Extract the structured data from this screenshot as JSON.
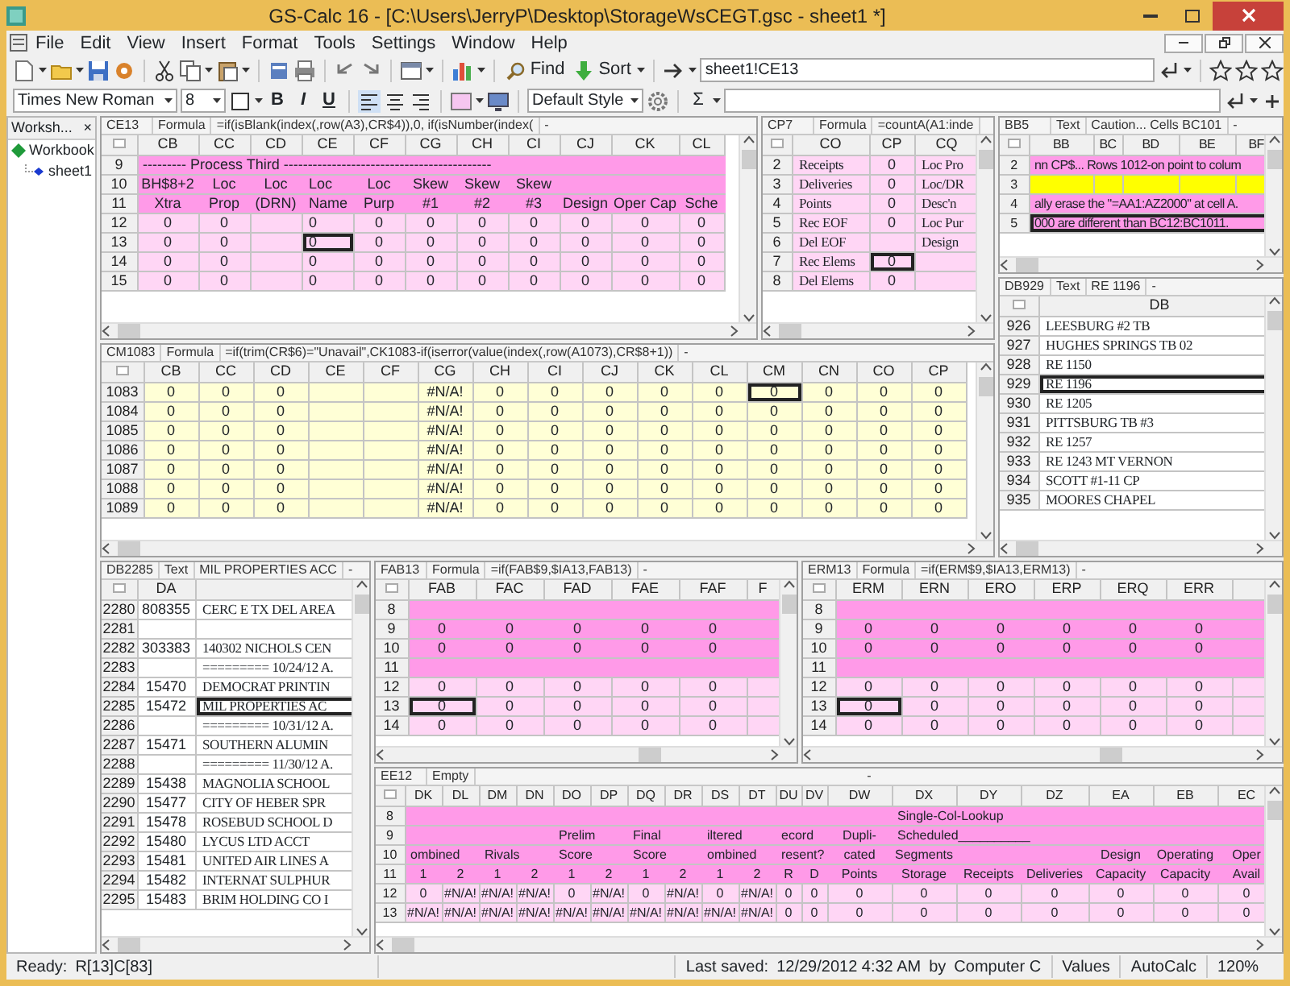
{
  "window": {
    "title": "GS-Calc 16 - [C:\\Users\\JerryP\\Desktop\\StorageWsCEGT.gsc - sheet1 *]"
  },
  "menu": [
    "File",
    "Edit",
    "View",
    "Insert",
    "Format",
    "Tools",
    "Settings",
    "Window",
    "Help"
  ],
  "toolbar": {
    "find": "Find",
    "sort": "Sort",
    "cell_reference": "sheet1!CE13"
  },
  "format_bar": {
    "font": "Times New Roman",
    "size": "8",
    "bold": "B",
    "italic": "I",
    "underline": "U",
    "style": "Default Style",
    "sum": "Σ"
  },
  "sidebar": {
    "title": "Worksh...",
    "close": "×",
    "tree": [
      {
        "label": "Workbook",
        "children": [
          {
            "label": "sheet1"
          }
        ]
      }
    ]
  },
  "panes": [
    {
      "ref": "CE13",
      "type": "Formula",
      "content": "=if(isBlank(index(,row(A3),CR$4)),0,   if(isNumber(index(",
      "suffix": "-",
      "columns": [
        {
          "label": "CB",
          "kind": "number"
        },
        {
          "label": "CC",
          "kind": "number"
        },
        {
          "label": "CD",
          "kind": "number"
        },
        {
          "label": "CE",
          "kind": "left"
        },
        {
          "label": "CF",
          "kind": "number"
        },
        {
          "label": "CG",
          "kind": "number"
        },
        {
          "label": "CH",
          "kind": "number"
        },
        {
          "label": "CI",
          "kind": "number"
        },
        {
          "label": "CJ",
          "kind": "number"
        },
        {
          "label": "CK",
          "kind": "number"
        },
        {
          "label": "CL",
          "kind": "number"
        }
      ],
      "rows": [
        {
          "header": "9",
          "kind": "heading",
          "cells": [
            {
              "text": "--------- Process Third -------------------------------------------",
              "colspan": 11
            }
          ]
        },
        {
          "header": "10",
          "kind": "heading",
          "cells": [
            "BH$8+2",
            "Loc",
            "Loc",
            "Loc",
            "Loc",
            "Skew",
            "Skew",
            "Skew",
            "",
            "",
            ""
          ]
        },
        {
          "header": "11",
          "kind": "heading",
          "cells": [
            "Xtra",
            "Prop",
            "(DRN)",
            "Name",
            "Purp",
            "#1",
            "#2",
            "#3",
            "Design",
            "Oper Cap",
            "Sche"
          ]
        },
        {
          "header": "12",
          "kind": "data",
          "cells": [
            "0",
            "0",
            "",
            "0",
            "0",
            "0",
            "0",
            "0",
            "0",
            "0",
            "0"
          ]
        },
        {
          "header": "13",
          "kind": "data",
          "cells": [
            "0",
            "0",
            "",
            {
              "text": "0",
              "selected": true
            },
            "0",
            "0",
            "0",
            "0",
            "0",
            "0",
            "0"
          ]
        },
        {
          "header": "14",
          "kind": "data",
          "cells": [
            "0",
            "0",
            "",
            "0",
            "0",
            "0",
            "0",
            "0",
            "0",
            "0",
            "0"
          ]
        },
        {
          "header": "15",
          "kind": "data",
          "cells": [
            "0",
            "0",
            "",
            "0",
            "0",
            "0",
            "0",
            "0",
            "0",
            "0",
            "0"
          ]
        }
      ]
    },
    {
      "ref": "CP7",
      "type": "Formula",
      "content": "=countA(A1:inde",
      "columns": [
        {
          "label": "CO",
          "kind": "text"
        },
        {
          "label": "CP",
          "kind": "number"
        },
        {
          "label": "CQ",
          "kind": "text"
        }
      ],
      "rows": [
        {
          "header": "2",
          "kind": "data",
          "cells": [
            "Receipts",
            "0",
            "Loc Pro"
          ]
        },
        {
          "header": "3",
          "kind": "data",
          "cells": [
            "Deliveries",
            "0",
            "Loc/DR"
          ]
        },
        {
          "header": "4",
          "kind": "data",
          "cells": [
            "Points",
            "0",
            "Desc'n"
          ]
        },
        {
          "header": "5",
          "kind": "data",
          "cells": [
            "Rec EOF",
            "0",
            "Loc Pur"
          ]
        },
        {
          "header": "6",
          "kind": "data",
          "cells": [
            "Del EOF",
            "",
            "Design"
          ]
        },
        {
          "header": "7",
          "kind": "data",
          "cells": [
            "Rec Elems",
            {
              "text": "0",
              "selected": true
            },
            ""
          ]
        },
        {
          "header": "8",
          "kind": "data",
          "cells": [
            "Del Elems",
            "0",
            ""
          ]
        }
      ]
    },
    {
      "ref": "CM1083",
      "type": "Formula",
      "content": "=if(trim(CR$6)=\"Unavail\",CK1083-if(iserror(value(index(,row(A1073),CR$8+1))",
      "suffix": "-",
      "columns": [
        {
          "label": "CB",
          "kind": "number"
        },
        {
          "label": "CC",
          "kind": "number"
        },
        {
          "label": "CD",
          "kind": "number"
        },
        {
          "label": "CE",
          "kind": "number"
        },
        {
          "label": "CF",
          "kind": "number"
        },
        {
          "label": "CG",
          "kind": "number"
        },
        {
          "label": "CH",
          "kind": "number"
        },
        {
          "label": "CI",
          "kind": "number"
        },
        {
          "label": "CJ",
          "kind": "number"
        },
        {
          "label": "CK",
          "kind": "number"
        },
        {
          "label": "CL",
          "kind": "number"
        },
        {
          "label": "CM",
          "kind": "number"
        },
        {
          "label": "CN",
          "kind": "number"
        },
        {
          "label": "CO",
          "kind": "number"
        },
        {
          "label": "CP",
          "kind": "number"
        }
      ],
      "rows": [
        {
          "header": "1083",
          "kind": "input",
          "cells": [
            "0",
            "0",
            "0",
            "",
            "",
            "#N/A!",
            "0",
            "0",
            "0",
            "0",
            "0",
            {
              "text": "0",
              "selected": true
            },
            "0",
            "0",
            "0"
          ]
        },
        {
          "header": "1084",
          "kind": "input",
          "cells": [
            "0",
            "0",
            "0",
            "",
            "",
            "#N/A!",
            "0",
            "0",
            "0",
            "0",
            "0",
            "0",
            "0",
            "0",
            "0"
          ]
        },
        {
          "header": "1085",
          "kind": "input",
          "cells": [
            "0",
            "0",
            "0",
            "",
            "",
            "#N/A!",
            "0",
            "0",
            "0",
            "0",
            "0",
            "0",
            "0",
            "0",
            "0"
          ]
        },
        {
          "header": "1086",
          "kind": "input",
          "cells": [
            "0",
            "0",
            "0",
            "",
            "",
            "#N/A!",
            "0",
            "0",
            "0",
            "0",
            "0",
            "0",
            "0",
            "0",
            "0"
          ]
        },
        {
          "header": "1087",
          "kind": "input",
          "cells": [
            "0",
            "0",
            "0",
            "",
            "",
            "#N/A!",
            "0",
            "0",
            "0",
            "0",
            "0",
            "0",
            "0",
            "0",
            "0"
          ]
        },
        {
          "header": "1088",
          "kind": "input",
          "cells": [
            "0",
            "0",
            "0",
            "",
            "",
            "#N/A!",
            "0",
            "0",
            "0",
            "0",
            "0",
            "0",
            "0",
            "0",
            "0"
          ]
        },
        {
          "header": "1089",
          "kind": "input",
          "cells": [
            "0",
            "0",
            "0",
            "",
            "",
            "#N/A!",
            "0",
            "0",
            "0",
            "0",
            "0",
            "0",
            "0",
            "0",
            "0"
          ]
        }
      ]
    },
    {
      "ref": "BB5",
      "type": "Text",
      "content": "Caution... Cells BC101",
      "suffix": "-",
      "columns": [
        {
          "label": "BB",
          "kind": "left"
        },
        {
          "label": "BC",
          "kind": "left"
        },
        {
          "label": "BD",
          "kind": "left"
        },
        {
          "label": "BE",
          "kind": "left"
        },
        {
          "label": "BF",
          "kind": "left"
        }
      ],
      "rows": [
        {
          "header": "2",
          "kind": "heading",
          "cells": [
            {
              "text": "nn CP$... Rows 1012-on point to colum",
              "colspan": 5
            }
          ]
        },
        {
          "header": "3",
          "kind": "highlight",
          "cells": [
            "",
            "",
            "",
            "",
            ""
          ]
        },
        {
          "header": "4",
          "kind": "heading",
          "cells": [
            {
              "text": "ally erase the \"=AA1:AZ2000\" at cell A.",
              "colspan": 5
            }
          ]
        },
        {
          "header": "5",
          "kind": "heading",
          "cells": [
            {
              "text": "000 are different than BC12:BC1011.",
              "selected": true,
              "colspan": 5
            }
          ]
        }
      ]
    },
    {
      "ref": "DB929",
      "type": "Text",
      "content": "RE 1196",
      "suffix": "-",
      "columns": [
        {
          "label": "DB",
          "kind": "text"
        }
      ],
      "rows": [
        {
          "header": "926",
          "kind": "plain",
          "cells": [
            "LEESBURG #2 TB"
          ]
        },
        {
          "header": "927",
          "kind": "plain",
          "cells": [
            "HUGHES SPRINGS TB 02"
          ]
        },
        {
          "header": "928",
          "kind": "plain",
          "cells": [
            "RE 1150"
          ]
        },
        {
          "header": "929",
          "kind": "plain",
          "cells": [
            {
              "text": "RE 1196",
              "selected": true
            }
          ]
        },
        {
          "header": "930",
          "kind": "plain",
          "cells": [
            "RE 1205"
          ]
        },
        {
          "header": "931",
          "kind": "plain",
          "cells": [
            "PITTSBURG TB #3"
          ]
        },
        {
          "header": "932",
          "kind": "plain",
          "cells": [
            "RE 1257"
          ]
        },
        {
          "header": "933",
          "kind": "plain",
          "cells": [
            "RE 1243 MT VERNON"
          ]
        },
        {
          "header": "934",
          "kind": "plain",
          "cells": [
            "SCOTT #1-11 CP"
          ]
        },
        {
          "header": "935",
          "kind": "plain",
          "cells": [
            "MOORES CHAPEL"
          ]
        }
      ]
    },
    {
      "ref": "DB2285",
      "type": "Text",
      "content": "MIL PROPERTIES ACC",
      "suffix": "-",
      "columns": [
        {
          "label": "DA",
          "kind": "number"
        },
        {
          "kind": "text"
        }
      ],
      "rows": [
        {
          "header": "2280",
          "kind": "plain",
          "cells": [
            "808355",
            "CERC E TX DEL AREA"
          ]
        },
        {
          "header": "2281",
          "kind": "plain",
          "cells": [
            "",
            ""
          ]
        },
        {
          "header": "2282",
          "kind": "plain",
          "cells": [
            "303383",
            "140302 NICHOLS CEN"
          ]
        },
        {
          "header": "2283",
          "kind": "plain",
          "cells": [
            "",
            "========= 10/24/12 A."
          ]
        },
        {
          "header": "2284",
          "kind": "plain",
          "cells": [
            "15470",
            "DEMOCRAT PRINTIN"
          ]
        },
        {
          "header": "2285",
          "kind": "plain",
          "cells": [
            "15472",
            {
              "text": "MIL PROPERTIES AC",
              "selected": true
            }
          ]
        },
        {
          "header": "2286",
          "kind": "plain",
          "cells": [
            "",
            "========= 10/31/12 A."
          ]
        },
        {
          "header": "2287",
          "kind": "plain",
          "cells": [
            "15471",
            "SOUTHERN ALUMIN"
          ]
        },
        {
          "header": "2288",
          "kind": "plain",
          "cells": [
            "",
            "========= 11/30/12 A."
          ]
        },
        {
          "header": "2289",
          "kind": "plain",
          "cells": [
            "15438",
            "MAGNOLIA SCHOOL"
          ]
        },
        {
          "header": "2290",
          "kind": "plain",
          "cells": [
            "15477",
            "CITY OF HEBER SPR"
          ]
        },
        {
          "header": "2291",
          "kind": "plain",
          "cells": [
            "15478",
            "ROSEBUD SCHOOL D"
          ]
        },
        {
          "header": "2292",
          "kind": "plain",
          "cells": [
            "15480",
            "LYCUS LTD ACCT"
          ]
        },
        {
          "header": "2293",
          "kind": "plain",
          "cells": [
            "15481",
            "UNITED AIR LINES A"
          ]
        },
        {
          "header": "2294",
          "kind": "plain",
          "cells": [
            "15482",
            "INTERNAT SULPHUR"
          ]
        },
        {
          "header": "2295",
          "kind": "plain",
          "cells": [
            "15483",
            "BRIM HOLDING CO I"
          ]
        }
      ]
    },
    {
      "ref": "FAB13",
      "type": "Formula",
      "content": "=if(FAB$9,$IA13,FAB13)",
      "suffix": "-",
      "columns": [
        {
          "label": "FAB",
          "kind": "number"
        },
        {
          "label": "FAC",
          "kind": "number"
        },
        {
          "label": "FAD",
          "kind": "number"
        },
        {
          "label": "FAE",
          "kind": "number"
        },
        {
          "label": "FAF",
          "kind": "number"
        },
        {
          "label": "F",
          "kind": "number"
        }
      ],
      "rows": [
        {
          "header": "8",
          "kind": "heading",
          "cells": [
            "",
            "",
            "",
            "",
            "",
            ""
          ]
        },
        {
          "header": "9",
          "kind": "heading",
          "cells": [
            "0",
            "0",
            "0",
            "0",
            "0",
            ""
          ]
        },
        {
          "header": "10",
          "kind": "heading",
          "cells": [
            "0",
            "0",
            "0",
            "0",
            "0",
            ""
          ]
        },
        {
          "header": "11",
          "kind": "heading",
          "cells": [
            "",
            "",
            "",
            "",
            "",
            ""
          ]
        },
        {
          "header": "12",
          "kind": "data",
          "cells": [
            "0",
            "0",
            "0",
            "0",
            "0",
            ""
          ]
        },
        {
          "header": "13",
          "kind": "data",
          "cells": [
            {
              "text": "0",
              "selected": true
            },
            "0",
            "0",
            "0",
            "0",
            ""
          ]
        },
        {
          "header": "14",
          "kind": "data",
          "cells": [
            "0",
            "0",
            "0",
            "0",
            "0",
            ""
          ]
        }
      ]
    },
    {
      "ref": "ERM13",
      "type": "Formula",
      "content": "=if(ERM$9,$IA13,ERM13)",
      "suffix": "-",
      "columns": [
        {
          "label": "ERM",
          "kind": "number"
        },
        {
          "label": "ERN",
          "kind": "number"
        },
        {
          "label": "ERO",
          "kind": "number"
        },
        {
          "label": "ERP",
          "kind": "number"
        },
        {
          "label": "ERQ",
          "kind": "number"
        },
        {
          "label": "ERR",
          "kind": "number"
        },
        {
          "kind": "number"
        }
      ],
      "rows": [
        {
          "header": "8",
          "kind": "heading",
          "cells": [
            "",
            "",
            "",
            "",
            "",
            "",
            ""
          ]
        },
        {
          "header": "9",
          "kind": "heading",
          "cells": [
            "0",
            "0",
            "0",
            "0",
            "0",
            "0",
            ""
          ]
        },
        {
          "header": "10",
          "kind": "heading",
          "cells": [
            "0",
            "0",
            "0",
            "0",
            "0",
            "0",
            ""
          ]
        },
        {
          "header": "11",
          "kind": "heading",
          "cells": [
            "",
            "",
            "",
            "",
            "",
            "",
            ""
          ]
        },
        {
          "header": "12",
          "kind": "data",
          "cells": [
            "0",
            "0",
            "0",
            "0",
            "0",
            "0",
            ""
          ]
        },
        {
          "header": "13",
          "kind": "data",
          "cells": [
            {
              "text": "0",
              "selected": true
            },
            "0",
            "0",
            "0",
            "0",
            "0",
            ""
          ]
        },
        {
          "header": "14",
          "kind": "data",
          "cells": [
            "0",
            "0",
            "0",
            "0",
            "0",
            "0",
            ""
          ]
        }
      ]
    },
    {
      "ref": "EE12",
      "type": "Empty",
      "suffix": "-",
      "columns": [
        {
          "label": "DK",
          "kind": "number"
        },
        {
          "label": "DL",
          "kind": "number"
        },
        {
          "label": "DM",
          "kind": "number"
        },
        {
          "label": "DN",
          "kind": "number"
        },
        {
          "label": "DO",
          "kind": "number"
        },
        {
          "label": "DP",
          "kind": "number"
        },
        {
          "label": "DQ",
          "kind": "number"
        },
        {
          "label": "DR",
          "kind": "number"
        },
        {
          "label": "DS",
          "kind": "number"
        },
        {
          "label": "DT",
          "kind": "number"
        },
        {
          "label": "DU",
          "kind": "number"
        },
        {
          "label": "DV",
          "kind": "number"
        },
        {
          "label": "DW",
          "kind": "number"
        },
        {
          "label": "DX",
          "kind": "number"
        },
        {
          "label": "DY",
          "kind": "number"
        },
        {
          "label": "DZ",
          "kind": "number"
        },
        {
          "label": "EA",
          "kind": "number"
        },
        {
          "label": "EB",
          "kind": "number"
        },
        {
          "label": "EC",
          "kind": "number"
        }
      ],
      "rows": [
        {
          "header": "8",
          "kind": "heading",
          "cells": [
            "",
            "",
            "",
            "",
            "",
            "",
            "",
            "",
            "",
            "",
            "",
            "",
            "",
            {
              "text": "Single-Col-Lookup",
              "colspan": 3
            },
            "",
            "",
            ""
          ]
        },
        {
          "header": "9",
          "kind": "heading",
          "cells": [
            "",
            "",
            "",
            "",
            {
              "text": "Prelim",
              "colspan": 2
            },
            {
              "text": "Final",
              "colspan": 2
            },
            {
              "text": "iltered",
              "colspan": 2
            },
            {
              "text": "ecord",
              "colspan": 2
            },
            "Dupli-",
            {
              "text": "Scheduled__________",
              "colspan": 3
            },
            "",
            "",
            ""
          ]
        },
        {
          "header": "10",
          "kind": "heading",
          "cells": [
            {
              "text": "ombined",
              "colspan": 2
            },
            {
              "text": "Rivals",
              "colspan": 2
            },
            {
              "text": "Score",
              "colspan": 2
            },
            {
              "text": "Score",
              "colspan": 2
            },
            {
              "text": "ombined",
              "colspan": 2
            },
            {
              "text": "resent?",
              "colspan": 2
            },
            "cated",
            "Segments",
            "",
            "",
            "Design",
            "Operating",
            "Oper"
          ]
        },
        {
          "header": "11",
          "kind": "heading",
          "cells": [
            "1",
            "2",
            "1",
            "2",
            "1",
            "2",
            "1",
            "2",
            "1",
            "2",
            "R",
            "D",
            "Points",
            "Storage",
            "Receipts",
            "Deliveries",
            "Capacity",
            "Capacity",
            "Avail"
          ]
        },
        {
          "header": "12",
          "kind": "data",
          "cells": [
            "0",
            "#N/A!",
            "#N/A!",
            "#N/A!",
            "0",
            "#N/A!",
            "0",
            "#N/A!",
            "0",
            "#N/A!",
            "0",
            "0",
            "0",
            "0",
            "0",
            "0",
            "0",
            "0",
            "0"
          ]
        },
        {
          "header": "13",
          "kind": "data",
          "cells": [
            "#N/A!",
            "#N/A!",
            "#N/A!",
            "#N/A!",
            "#N/A!",
            "#N/A!",
            "#N/A!",
            "#N/A!",
            "#N/A!",
            "#N/A!",
            "0",
            "0",
            "0",
            "0",
            "0",
            "0",
            "0",
            "0",
            "0"
          ]
        }
      ]
    }
  ],
  "status_bar": {
    "ready": "Ready:",
    "position": "R[13]C[83]",
    "last_saved_label": "Last saved:",
    "last_saved": "12/29/2012 4:32 AM",
    "by": "by",
    "user": "Computer C",
    "mode": "Values",
    "calc": "AutoCalc",
    "zoom": "120%"
  }
}
